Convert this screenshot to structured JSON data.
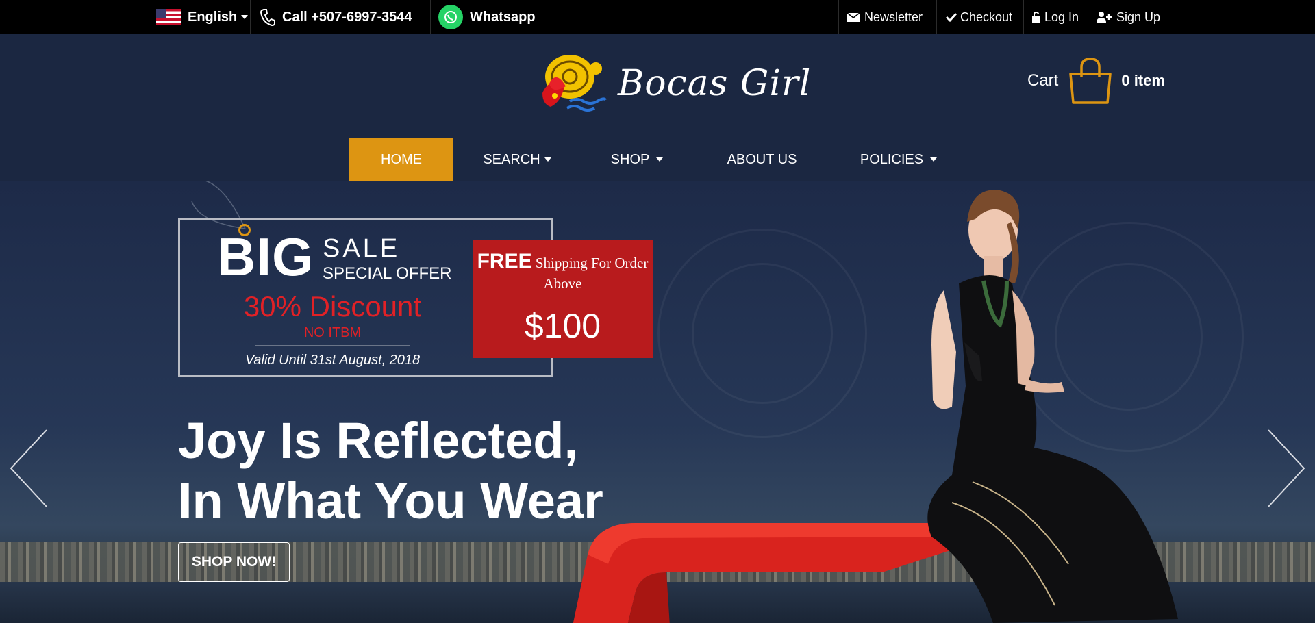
{
  "topbar": {
    "language": "English",
    "phone": "Call +507-6997-3544",
    "whatsapp": "Whatsapp",
    "links": [
      {
        "label": "Newsletter",
        "icon": "envelope-icon"
      },
      {
        "label": "Checkout",
        "icon": "check-icon"
      },
      {
        "label": "Log In",
        "icon": "lock-icon"
      },
      {
        "label": "Sign Up",
        "icon": "user-plus-icon"
      }
    ]
  },
  "header": {
    "logo_text": "Bocas Girl",
    "cart_label": "Cart",
    "cart_count": "0 item"
  },
  "nav": {
    "items": [
      {
        "label": "HOME",
        "active": true
      },
      {
        "label": "SEARCH",
        "dropdown": true
      },
      {
        "label": "SHOP",
        "dropdown": true
      },
      {
        "label": "ABOUT US"
      },
      {
        "label": "POLICIES",
        "dropdown": true
      }
    ]
  },
  "hero": {
    "big": "BIG",
    "sale": "SALE",
    "special_offer": "SPECIAL OFFER",
    "discount": "30% Discount",
    "no_itbm": "NO ITBM",
    "valid": "Valid Until 31st August, 2018",
    "free": "FREE",
    "shipping": "Shipping For Order Above",
    "price": "$100",
    "headline_line1": "Joy Is Reflected,",
    "headline_line2": "In What You Wear",
    "cta": "SHOP NOW!"
  },
  "colors": {
    "accent": "#dd9512",
    "sale_red": "#b81b1d",
    "discount_red": "#e12126",
    "header_bg": "#1b2741",
    "topbar_bg": "#000000"
  }
}
